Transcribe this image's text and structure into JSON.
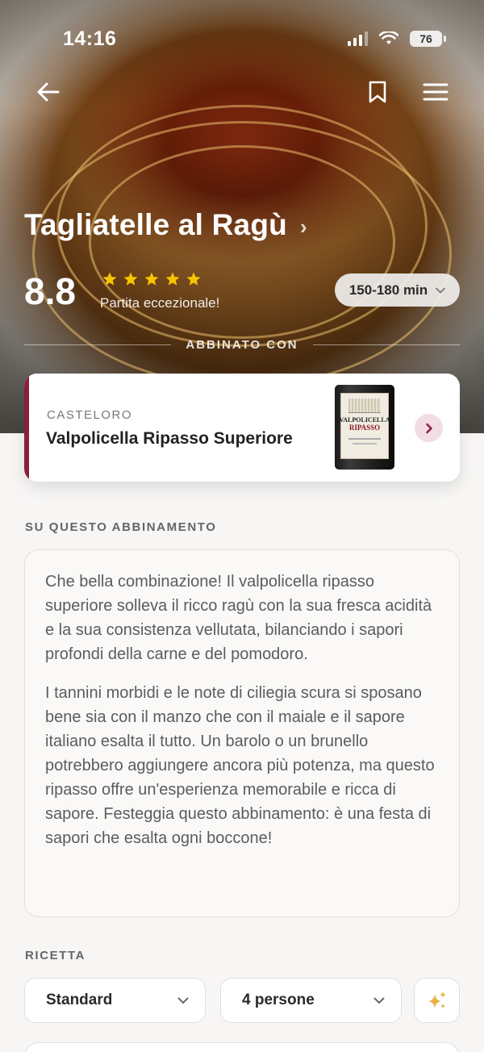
{
  "status_bar": {
    "time": "14:16",
    "battery": "76"
  },
  "hero": {
    "title": "Tagliatelle al Ragù",
    "score": "8.8",
    "stars": 5,
    "rating_label": "Partita eccezionale!",
    "cook_time": "150-180 min",
    "paired_with_label": "ABBINATO CON"
  },
  "wine": {
    "producer": "CASTELORO",
    "name": "Valpolicella Ripasso Superiore",
    "bottle_label_line1": "VALPOLICELLA",
    "bottle_label_line2": "RIPASSO",
    "accent_color": "#8c1d3c"
  },
  "about": {
    "label": "SU QUESTO ABBINAMENTO",
    "paragraphs": [
      "Che bella combinazione! Il valpolicella ripasso superiore solleva il ricco ragù con la sua fresca acidità e la sua consistenza vellutata, bilanciando i sapori profondi della carne e del pomodoro.",
      "I tannini morbidi e le note di ciliegia scura si sposano bene sia con il manzo che con il maiale e il sapore italiano esalta il tutto. Un barolo o un brunello potrebbero aggiungere ancora più potenza, ma questo ripasso offre un'esperienza memorabile e ricca di sapore. Festeggia questo abbinamento: è una festa di sapori che esalta ogni boccone!"
    ]
  },
  "recipe": {
    "label": "RICETTA",
    "version": "Standard",
    "servings": "4 persone"
  },
  "colors": {
    "star": "#f7c400",
    "sparkle": "#e8b040"
  }
}
